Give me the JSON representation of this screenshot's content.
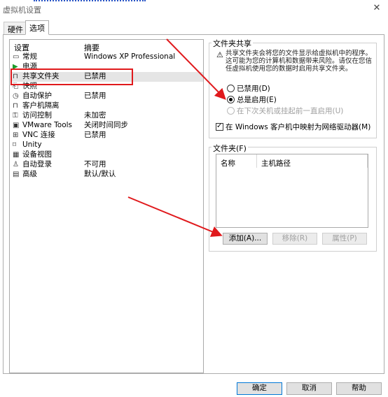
{
  "window": {
    "title": "虚拟机设置",
    "close_glyph": "✕"
  },
  "tabs": [
    {
      "label": "硬件",
      "active": false
    },
    {
      "label": "选项",
      "active": true
    }
  ],
  "settings_list": {
    "header_setting": "设置",
    "header_summary": "摘要",
    "items": [
      {
        "name": "常规",
        "summary": "Windows XP Professional",
        "icon": "general-icon"
      },
      {
        "name": "电源",
        "summary": "",
        "icon": "power-icon"
      },
      {
        "name": "共享文件夹",
        "summary": "已禁用",
        "icon": "shared-folder-icon",
        "selected": true
      },
      {
        "name": "快照",
        "summary": "",
        "icon": "snapshot-icon"
      },
      {
        "name": "自动保护",
        "summary": "已禁用",
        "icon": "autoprotect-icon"
      },
      {
        "name": "客户机隔离",
        "summary": "",
        "icon": "lock-icon"
      },
      {
        "name": "访问控制",
        "summary": "未加密",
        "icon": "access-control-icon"
      },
      {
        "name": "VMware Tools",
        "summary": "关闭时间同步",
        "icon": "vmware-tools-icon"
      },
      {
        "name": "VNC 连接",
        "summary": "已禁用",
        "icon": "vnc-icon"
      },
      {
        "name": "Unity",
        "summary": "",
        "icon": "unity-icon"
      },
      {
        "name": "设备视图",
        "summary": "",
        "icon": "device-view-icon"
      },
      {
        "name": "自动登录",
        "summary": "不可用",
        "icon": "autologin-icon"
      },
      {
        "name": "高级",
        "summary": "默认/默认",
        "icon": "advanced-icon"
      }
    ]
  },
  "folder_sharing": {
    "title": "文件夹共享",
    "warning_icon": "⚠",
    "info": "共享文件夹会将您的文件显示给虚拟机中的程序。这可能为您的计算机和数据带来风险。请仅在您信任虚拟机使用您的数据时启用共享文件夹。",
    "options": [
      {
        "label": "已禁用(D)",
        "selected": false,
        "disabled": false
      },
      {
        "label": "总是启用(E)",
        "selected": true,
        "disabled": false
      },
      {
        "label": "在下次关机或挂起前一直启用(U)",
        "selected": false,
        "disabled": true
      }
    ],
    "map_drive_label": "在 Windows 客户机中映射为网络驱动器(M)",
    "map_drive_checked": true
  },
  "folders": {
    "title": "文件夹(F)",
    "columns": [
      "名称",
      "主机路径"
    ],
    "add_button": "添加(A)...",
    "remove_button": "移除(R)",
    "properties_button": "属性(P)"
  },
  "footer": {
    "ok": "确定",
    "cancel": "取消",
    "help": "帮助"
  },
  "colors": {
    "annotation_red": "#e0191c",
    "selection_bg": "#e5e5e5",
    "default_button_border": "#0078d7"
  }
}
